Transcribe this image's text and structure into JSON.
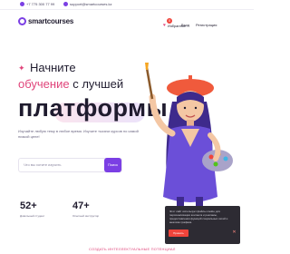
{
  "topbar": {
    "phone": "+7 775 300 77 99",
    "email": "support@smartcourses.kz"
  },
  "header": {
    "logo": "smartcourses",
    "favorites_label": "Избранное",
    "favorites_count": "0",
    "login_label": "Вход",
    "register_label": "Регистрация"
  },
  "hero": {
    "line1": "Начните",
    "line2_highlight": "обучение",
    "line2_rest": "с лучшей",
    "line3": "платформы",
    "description": "Изучайте любую тему в любое время. Изучите тысячи курсов по самой низкой цене!"
  },
  "search": {
    "placeholder": "Что вы хотите изучить",
    "button_label": "Поиск"
  },
  "stats": [
    {
      "value": "52+",
      "label": "Довольный студент"
    },
    {
      "value": "47+",
      "label": "Опытный инструктор"
    }
  ],
  "cookie": {
    "text": "Этот сайт использует файлы cookie для персонализации контента и рекламы, предоставления функций социальных сетей и анализа трафика.",
    "accept_label": "Принять",
    "close_icon": "close-icon"
  },
  "bottom": {
    "link_text": "СОЗДАТЬ ИНТЕЛЛЕКТУАЛЬНЫЕ ПОТЕНЦИАЛ"
  },
  "colors": {
    "accent": "#7b3fe4",
    "pink": "#e0457b",
    "cookie_bg": "#2d2b33",
    "danger": "#f0443b"
  }
}
